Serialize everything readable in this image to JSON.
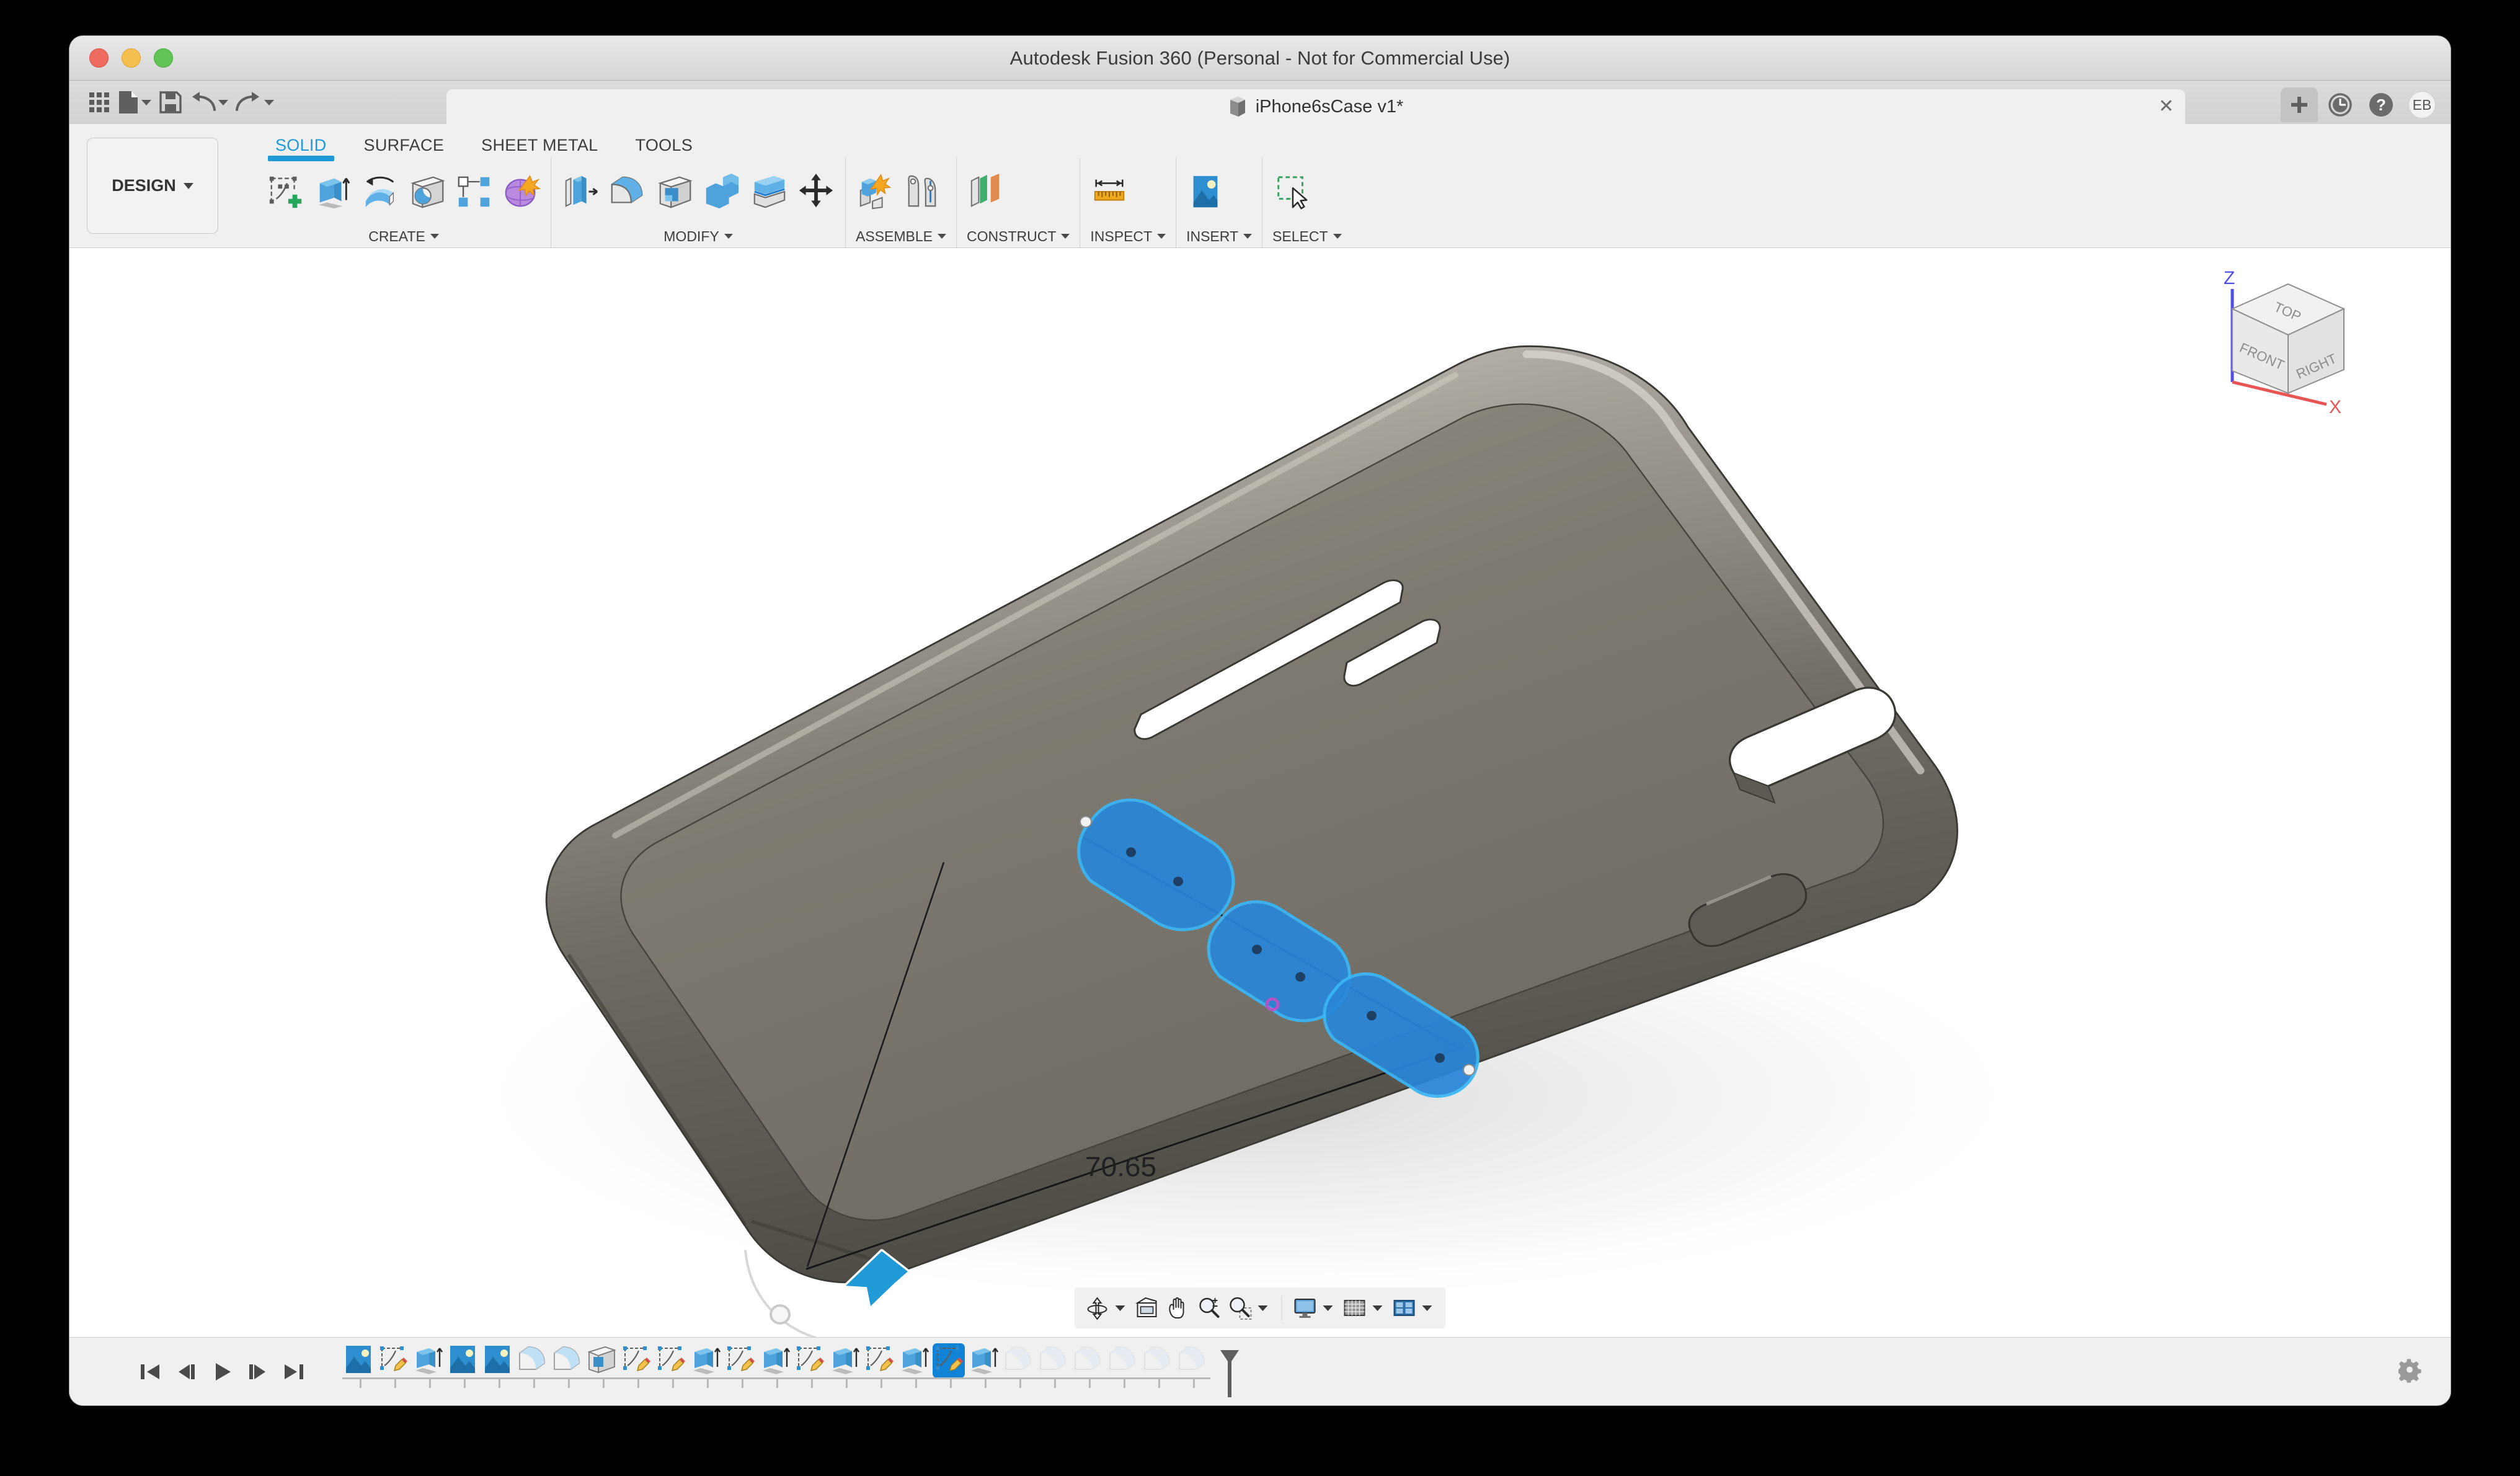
{
  "window": {
    "app_title": "Autodesk Fusion 360 (Personal - Not for Commercial Use)",
    "traffic_lights": [
      "close-red",
      "minimize-yellow",
      "zoom-green"
    ]
  },
  "quick_access": {
    "items": [
      {
        "name": "app-grid-button",
        "label": "Show Data Panel",
        "icon": "grid-icon",
        "caret": false
      },
      {
        "name": "file-button",
        "label": "File",
        "icon": "file-icon",
        "caret": true
      },
      {
        "name": "save-button",
        "label": "Save",
        "icon": "save-icon",
        "caret": false
      },
      {
        "name": "undo-button",
        "label": "Undo",
        "icon": "undo-icon",
        "caret": true
      },
      {
        "name": "redo-button",
        "label": "Redo",
        "icon": "redo-icon",
        "caret": true
      }
    ]
  },
  "document_tab": {
    "label": "iPhone6sCase v1*",
    "icon": "document-cube-icon",
    "close_label": "✕"
  },
  "tab_right_controls": [
    {
      "name": "new-tab-button",
      "label": "+",
      "icon": "plus-icon"
    },
    {
      "name": "job-status-button",
      "label": "Job Status",
      "icon": "clock-icon"
    },
    {
      "name": "help-button",
      "label": "Help",
      "icon": "question-icon"
    },
    {
      "name": "account-avatar",
      "label": "EB",
      "icon": "avatar-icon"
    }
  ],
  "workspace": {
    "selector_label": "DESIGN"
  },
  "ribbon": {
    "tabs": [
      {
        "label": "SOLID",
        "active": true
      },
      {
        "label": "SURFACE",
        "active": false
      },
      {
        "label": "SHEET METAL",
        "active": false
      },
      {
        "label": "TOOLS",
        "active": false
      }
    ],
    "panels": [
      {
        "name": "CREATE",
        "label": "CREATE",
        "has_caret": true,
        "tools": [
          {
            "name": "create-sketch-icon",
            "label": "Create Sketch"
          },
          {
            "name": "extrude-icon",
            "label": "Extrude"
          },
          {
            "name": "revolve-icon",
            "label": "Revolve"
          },
          {
            "name": "hole-icon",
            "label": "Hole"
          },
          {
            "name": "pattern-icon",
            "label": "Pattern"
          },
          {
            "name": "create-form-icon",
            "label": "Create Form"
          }
        ]
      },
      {
        "name": "MODIFY",
        "label": "MODIFY",
        "has_caret": true,
        "tools": [
          {
            "name": "press-pull-icon",
            "label": "Press Pull"
          },
          {
            "name": "fillet-icon",
            "label": "Fillet"
          },
          {
            "name": "shell-icon",
            "label": "Shell"
          },
          {
            "name": "combine-icon",
            "label": "Combine"
          },
          {
            "name": "split-face-icon",
            "label": "Split Face"
          },
          {
            "name": "move-copy-icon",
            "label": "Move/Copy"
          }
        ]
      },
      {
        "name": "ASSEMBLE",
        "label": "ASSEMBLE",
        "has_caret": true,
        "tools": [
          {
            "name": "new-component-icon",
            "label": "New Component"
          },
          {
            "name": "joint-icon",
            "label": "Joint"
          }
        ]
      },
      {
        "name": "CONSTRUCT",
        "label": "CONSTRUCT",
        "has_caret": true,
        "tools": [
          {
            "name": "offset-plane-icon",
            "label": "Offset Plane"
          }
        ]
      },
      {
        "name": "INSPECT",
        "label": "INSPECT",
        "has_caret": true,
        "tools": [
          {
            "name": "measure-icon",
            "label": "Measure"
          }
        ]
      },
      {
        "name": "INSERT",
        "label": "INSERT",
        "has_caret": true,
        "tools": [
          {
            "name": "insert-image-icon",
            "label": "Canvas"
          }
        ]
      },
      {
        "name": "SELECT",
        "label": "SELECT",
        "has_caret": true,
        "tools": [
          {
            "name": "select-window-icon",
            "label": "Select"
          }
        ]
      }
    ]
  },
  "canvas": {
    "background_top": "#ffffff",
    "background_bottom": "#ffffff",
    "model": {
      "name": "iphone-case-body",
      "description": "iPhone 6s protective case shown in isometric orientation",
      "body_color": "#7c786f",
      "body_highlight": "#b6b2a7",
      "body_shadow": "#4e4b45",
      "cutouts": [
        "volume-button-slot",
        "mute-switch-slot",
        "camera-cutout",
        "power-button-slot"
      ]
    },
    "sketch": {
      "accent_color": "#1f7fd4",
      "construction_line_color": "#1a1a1a",
      "slots": [
        {
          "name": "slot-profile-1"
        },
        {
          "name": "slot-profile-2"
        },
        {
          "name": "slot-profile-3"
        }
      ],
      "dimension": {
        "name": "linear-dimension",
        "value": "70.65"
      },
      "direction_arrow": {
        "name": "extent-direction-arrow",
        "color": "#1f9ad6"
      }
    },
    "viewcube": {
      "faces": {
        "top": "TOP",
        "front": "FRONT",
        "right": "RIGHT"
      },
      "axes": [
        {
          "label": "Z",
          "color": "#4f4fe8"
        },
        {
          "label": "X",
          "color": "#e85555"
        }
      ]
    },
    "navbar": [
      {
        "name": "orbit-icon",
        "label": "Orbit",
        "caret": true
      },
      {
        "name": "look-at-icon",
        "label": "Look At",
        "caret": false
      },
      {
        "name": "pan-icon",
        "label": "Pan",
        "caret": false
      },
      {
        "name": "zoom-icon",
        "label": "Zoom",
        "caret": false
      },
      {
        "name": "fit-icon",
        "label": "Fit",
        "caret": true
      },
      {
        "name": "display-settings-icon",
        "label": "Display Settings",
        "caret": true
      },
      {
        "name": "grid-snaps-icon",
        "label": "Grid and Snaps",
        "caret": true
      },
      {
        "name": "viewports-icon",
        "label": "Viewports",
        "caret": true
      }
    ]
  },
  "timeline": {
    "playback": [
      {
        "name": "go-to-beginning-button",
        "label": "Go to Beginning"
      },
      {
        "name": "step-back-button",
        "label": "Step Back"
      },
      {
        "name": "play-button",
        "label": "Play"
      },
      {
        "name": "step-forward-button",
        "label": "Step Forward"
      },
      {
        "name": "go-to-end-button",
        "label": "Go to End"
      }
    ],
    "features": [
      {
        "name": "canvas-feature",
        "icon": "canvas-image-icon",
        "state": "normal"
      },
      {
        "name": "sketch-feature",
        "icon": "sketch-icon",
        "state": "normal"
      },
      {
        "name": "extrude-feature",
        "icon": "extrude-icon",
        "state": "normal"
      },
      {
        "name": "canvas-feature",
        "icon": "canvas-image-icon",
        "state": "normal"
      },
      {
        "name": "canvas-feature",
        "icon": "canvas-image-icon",
        "state": "normal"
      },
      {
        "name": "fillet-feature",
        "icon": "fillet-icon",
        "state": "normal"
      },
      {
        "name": "fillet-feature",
        "icon": "fillet-icon",
        "state": "normal"
      },
      {
        "name": "shell-feature",
        "icon": "shell-icon",
        "state": "normal"
      },
      {
        "name": "sketch-feature",
        "icon": "sketch-icon",
        "state": "normal"
      },
      {
        "name": "sketch-feature",
        "icon": "sketch-icon",
        "state": "normal"
      },
      {
        "name": "extrude-feature",
        "icon": "extrude-icon",
        "state": "normal"
      },
      {
        "name": "sketch-feature",
        "icon": "sketch-icon",
        "state": "normal"
      },
      {
        "name": "extrude-feature",
        "icon": "extrude-icon",
        "state": "normal"
      },
      {
        "name": "sketch-feature",
        "icon": "sketch-icon",
        "state": "normal"
      },
      {
        "name": "extrude-feature",
        "icon": "extrude-icon",
        "state": "normal"
      },
      {
        "name": "sketch-feature",
        "icon": "sketch-icon",
        "state": "normal"
      },
      {
        "name": "extrude-feature",
        "icon": "extrude-icon",
        "state": "normal"
      },
      {
        "name": "sketch-feature",
        "icon": "sketch-icon",
        "state": "selected"
      },
      {
        "name": "extrude-feature",
        "icon": "extrude-icon",
        "state": "normal"
      },
      {
        "name": "fillet-feature",
        "icon": "fillet-icon",
        "state": "rolled-back"
      },
      {
        "name": "fillet-feature",
        "icon": "fillet-icon",
        "state": "rolled-back"
      },
      {
        "name": "fillet-feature",
        "icon": "fillet-icon",
        "state": "rolled-back"
      },
      {
        "name": "fillet-feature",
        "icon": "fillet-icon",
        "state": "rolled-back"
      },
      {
        "name": "fillet-feature",
        "icon": "fillet-icon",
        "state": "rolled-back"
      },
      {
        "name": "fillet-feature",
        "icon": "fillet-icon",
        "state": "rolled-back"
      }
    ],
    "marker": {
      "name": "timeline-marker",
      "label": "Timeline Marker"
    },
    "settings": {
      "name": "timeline-settings-gear",
      "label": "Timeline Settings"
    }
  }
}
